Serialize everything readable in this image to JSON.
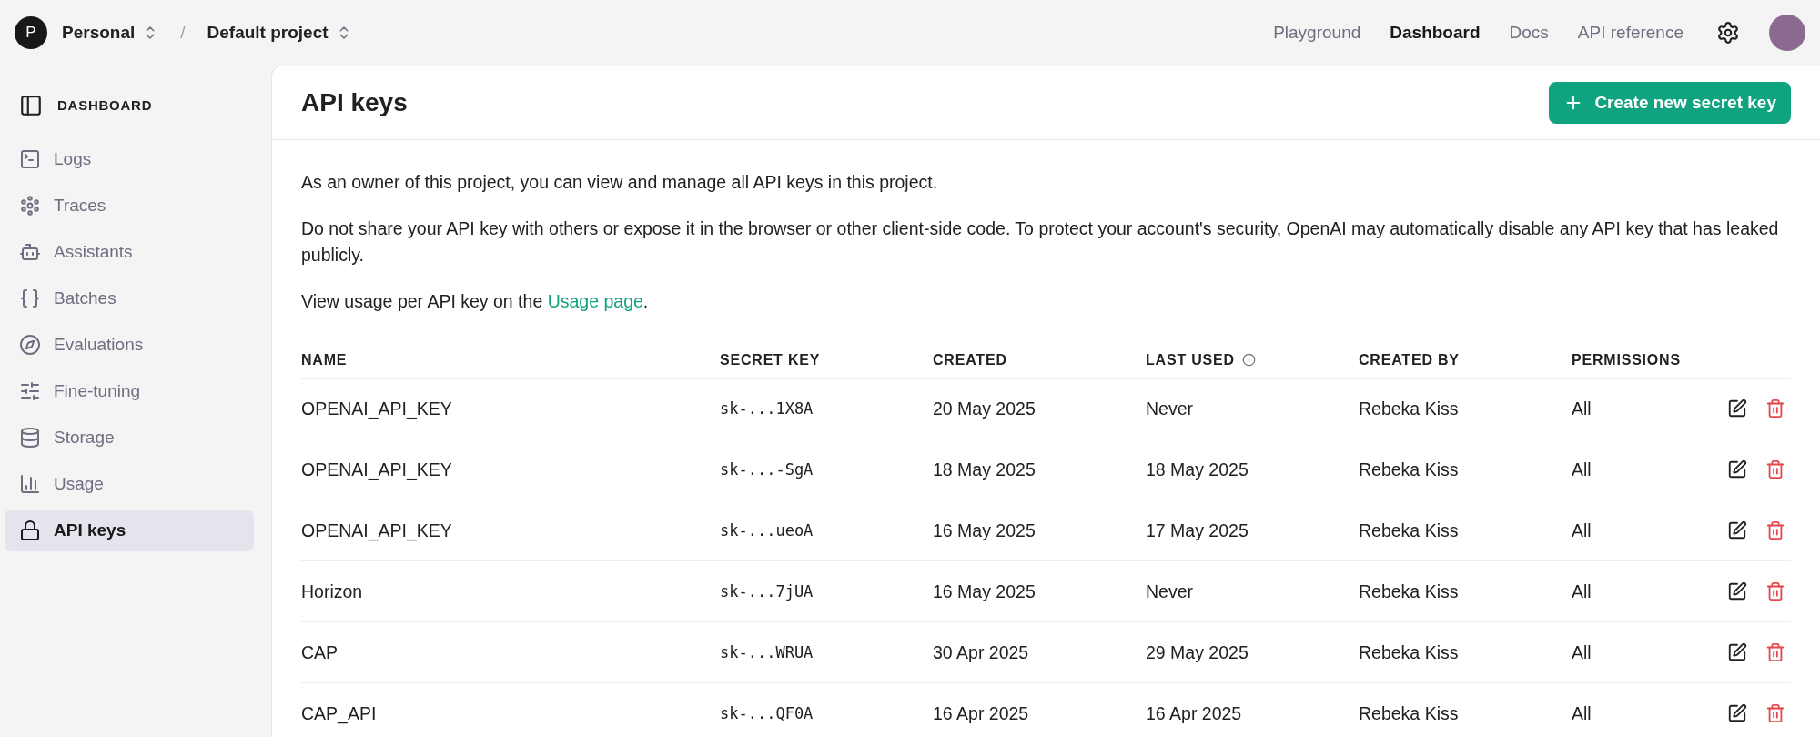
{
  "topbar": {
    "org_initial": "P",
    "org": "Personal",
    "separator": "/",
    "project": "Default project",
    "nav": [
      {
        "label": "Playground",
        "selected": false
      },
      {
        "label": "Dashboard",
        "selected": true
      },
      {
        "label": "Docs",
        "selected": false
      },
      {
        "label": "API reference",
        "selected": false
      }
    ]
  },
  "sidebar": {
    "heading": "DASHBOARD",
    "items": [
      {
        "label": "Logs",
        "selected": false
      },
      {
        "label": "Traces",
        "selected": false
      },
      {
        "label": "Assistants",
        "selected": false
      },
      {
        "label": "Batches",
        "selected": false
      },
      {
        "label": "Evaluations",
        "selected": false
      },
      {
        "label": "Fine-tuning",
        "selected": false
      },
      {
        "label": "Storage",
        "selected": false
      },
      {
        "label": "Usage",
        "selected": false
      },
      {
        "label": "API keys",
        "selected": true
      }
    ]
  },
  "page": {
    "title": "API keys",
    "create_button": "Create new secret key",
    "paragraphs": [
      "As an owner of this project, you can view and manage all API keys in this project.",
      "Do not share your API key with others or expose it in the browser or other client-side code. To protect your account's security, OpenAI may automatically disable any API key that has leaked publicly."
    ],
    "usage_note": {
      "before": "View usage per API key on the ",
      "link": "Usage page",
      "after": "."
    }
  },
  "table": {
    "columns": [
      "NAME",
      "SECRET KEY",
      "CREATED",
      "LAST USED",
      "CREATED BY",
      "PERMISSIONS"
    ],
    "rows": [
      [
        "OPENAI_API_KEY",
        "sk-...1X8A",
        "20 May 2025",
        "Never",
        "Rebeka Kiss",
        "All"
      ],
      [
        "OPENAI_API_KEY",
        "sk-...-SgA",
        "18 May 2025",
        "18 May 2025",
        "Rebeka Kiss",
        "All"
      ],
      [
        "OPENAI_API_KEY",
        "sk-...ueoA",
        "16 May 2025",
        "17 May 2025",
        "Rebeka Kiss",
        "All"
      ],
      [
        "Horizon",
        "sk-...7jUA",
        "16 May 2025",
        "Never",
        "Rebeka Kiss",
        "All"
      ],
      [
        "CAP",
        "sk-...WRUA",
        "30 Apr 2025",
        "29 May 2025",
        "Rebeka Kiss",
        "All"
      ],
      [
        "CAP_API",
        "sk-...QF0A",
        "16 Apr 2025",
        "16 Apr 2025",
        "Rebeka Kiss",
        "All"
      ]
    ]
  }
}
